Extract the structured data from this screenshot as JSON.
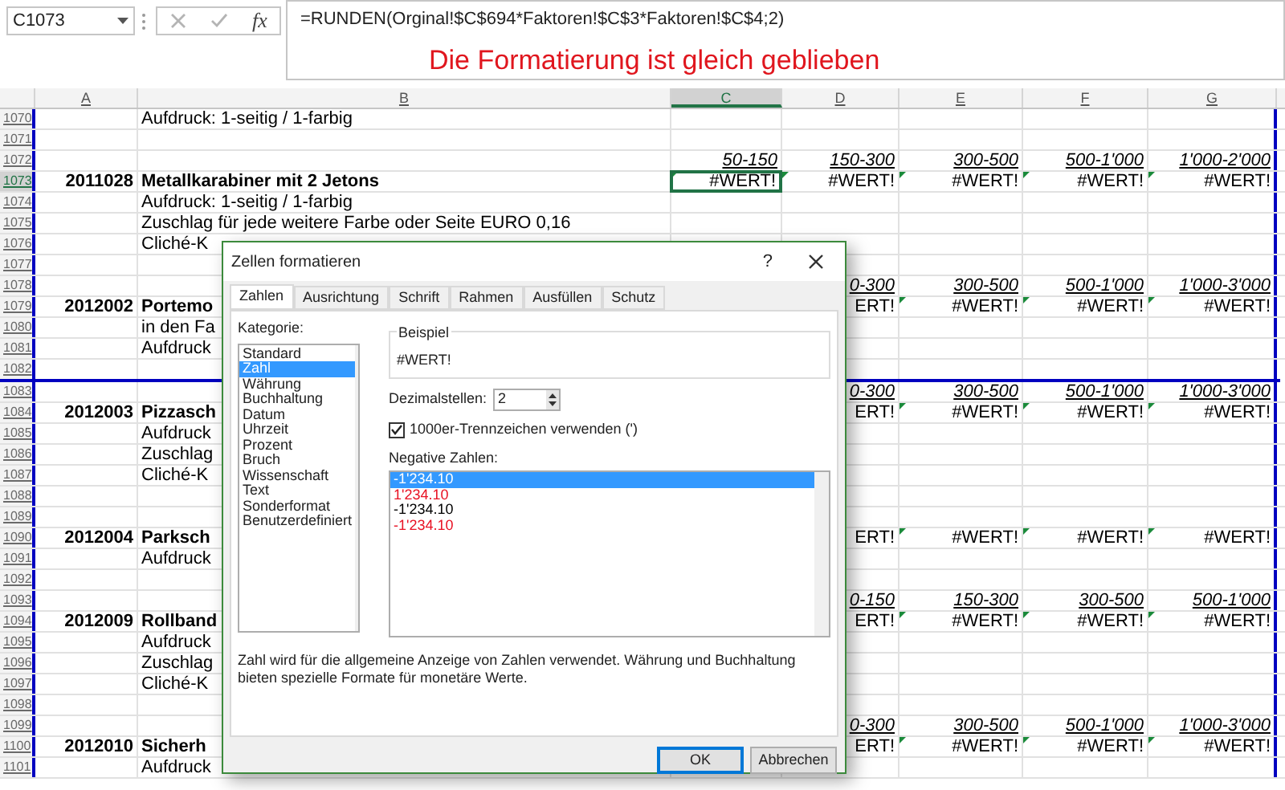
{
  "name_box": {
    "value": "C1073"
  },
  "formula_bar": {
    "function_label": "fx",
    "formula": "=RUNDEN(Orginal!$C$694*Faktoren!$C$3*Faktoren!$C$4;2)",
    "annotation": "Die Formatierung ist gleich geblieben"
  },
  "columns": [
    {
      "label": "A",
      "selected": false
    },
    {
      "label": "B",
      "selected": false
    },
    {
      "label": "C",
      "selected": true
    },
    {
      "label": "D",
      "selected": false
    },
    {
      "label": "E",
      "selected": false
    },
    {
      "label": "F",
      "selected": false
    },
    {
      "label": "G",
      "selected": false
    }
  ],
  "rows": [
    {
      "number": "1070",
      "selected": false,
      "text": "Aufdruck: 1-seitig / 1-farbig"
    },
    {
      "number": "1071",
      "selected": false
    },
    {
      "number": "1072",
      "selected": false,
      "ranges": [
        "50-150",
        "150-300",
        "300-500",
        "500-1'000",
        "1'000-2'000"
      ]
    },
    {
      "number": "1073",
      "selected": true,
      "item_no": "2011028",
      "title": "Metallkarabiner mit 2 Jetons",
      "values": [
        "#WERT!",
        "#WERT!",
        "#WERT!",
        "#WERT!",
        "#WERT!"
      ]
    },
    {
      "number": "1074",
      "selected": false,
      "text": "Aufdruck: 1-seitig / 1-farbig"
    },
    {
      "number": "1075",
      "selected": false,
      "text": "Zuschlag für jede weitere Farbe oder Seite EURO 0,16"
    },
    {
      "number": "1076",
      "selected": false,
      "text": "Cliché-K"
    },
    {
      "number": "1077",
      "selected": false
    },
    {
      "number": "1078",
      "selected": false,
      "ranges": [
        "0-300",
        "300-500",
        "500-1'000",
        "1'000-3'000"
      ]
    },
    {
      "number": "1079",
      "selected": false,
      "item_no": "2012002",
      "title": "Portemo",
      "values": [
        "ERT!",
        "#WERT!",
        "#WERT!",
        "#WERT!"
      ]
    },
    {
      "number": "1080",
      "selected": false,
      "text": "in den Fa"
    },
    {
      "number": "1081",
      "selected": false,
      "text": "Aufdruck"
    },
    {
      "number": "1082",
      "selected": false,
      "page_break_below": true
    },
    {
      "number": "1083",
      "selected": false,
      "ranges": [
        "0-300",
        "300-500",
        "500-1'000",
        "1'000-3'000"
      ]
    },
    {
      "number": "1084",
      "selected": false,
      "item_no": "2012003",
      "title": "Pizzasch",
      "values": [
        "ERT!",
        "#WERT!",
        "#WERT!",
        "#WERT!"
      ]
    },
    {
      "number": "1085",
      "selected": false,
      "text": "Aufdruck"
    },
    {
      "number": "1086",
      "selected": false,
      "text": "Zuschlag"
    },
    {
      "number": "1087",
      "selected": false,
      "text": "Cliché-K"
    },
    {
      "number": "1088",
      "selected": false
    },
    {
      "number": "1089",
      "selected": false
    },
    {
      "number": "1090",
      "selected": false,
      "item_no": "2012004",
      "title": "Parksch",
      "values": [
        "ERT!",
        "#WERT!",
        "#WERT!",
        "#WERT!"
      ]
    },
    {
      "number": "1091",
      "selected": false,
      "text": "Aufdruck"
    },
    {
      "number": "1092",
      "selected": false
    },
    {
      "number": "1093",
      "selected": false,
      "ranges": [
        "0-150",
        "150-300",
        "300-500",
        "500-1'000"
      ]
    },
    {
      "number": "1094",
      "selected": false,
      "item_no": "2012009",
      "title": "Rollband",
      "values": [
        "ERT!",
        "#WERT!",
        "#WERT!",
        "#WERT!"
      ]
    },
    {
      "number": "1095",
      "selected": false,
      "text": "Aufdruck"
    },
    {
      "number": "1096",
      "selected": false,
      "text": "Zuschlag"
    },
    {
      "number": "1097",
      "selected": false,
      "text": "Cliché-K"
    },
    {
      "number": "1098",
      "selected": false
    },
    {
      "number": "1099",
      "selected": false,
      "ranges": [
        "0-300",
        "300-500",
        "500-1'000",
        "1'000-3'000"
      ]
    },
    {
      "number": "1100",
      "selected": false,
      "item_no": "2012010",
      "title": "Sicherh",
      "values": [
        "ERT!",
        "#WERT!",
        "#WERT!",
        "#WERT!"
      ]
    },
    {
      "number": "1101",
      "selected": false,
      "text": "Aufdruck"
    }
  ],
  "dialog": {
    "title": "Zellen formatieren",
    "help": "?",
    "tabs": [
      {
        "label": "Zahlen",
        "selected": true
      },
      {
        "label": "Ausrichtung",
        "selected": false
      },
      {
        "label": "Schrift",
        "selected": false
      },
      {
        "label": "Rahmen",
        "selected": false
      },
      {
        "label": "Ausfüllen",
        "selected": false
      },
      {
        "label": "Schutz",
        "selected": false
      }
    ],
    "category_label": "Kategorie:",
    "categories": [
      {
        "label": "Standard",
        "selected": false
      },
      {
        "label": "Zahl",
        "selected": true
      },
      {
        "label": "Währung",
        "selected": false
      },
      {
        "label": "Buchhaltung",
        "selected": false
      },
      {
        "label": "Datum",
        "selected": false
      },
      {
        "label": "Uhrzeit",
        "selected": false
      },
      {
        "label": "Prozent",
        "selected": false
      },
      {
        "label": "Bruch",
        "selected": false
      },
      {
        "label": "Wissenschaft",
        "selected": false
      },
      {
        "label": "Text",
        "selected": false
      },
      {
        "label": "Sonderformat",
        "selected": false
      },
      {
        "label": "Benutzerdefiniert",
        "selected": false
      }
    ],
    "sample_label": "Beispiel",
    "sample_value": "#WERT!",
    "decimals_label": "Dezimalstellen:",
    "decimals_value": "2",
    "separator": {
      "label": "1000er-Trennzeichen verwenden (')",
      "checked": true
    },
    "negative_label": "Negative Zahlen:",
    "negative_formats": [
      {
        "label": "-1'234.10",
        "selected": true
      },
      {
        "label": "1'234.10",
        "selected": false,
        "color": "#e81123"
      },
      {
        "label": "-1'234.10",
        "selected": false,
        "color": "#000000"
      },
      {
        "label": "-1'234.10",
        "selected": false,
        "color": "#e81123"
      }
    ],
    "description": "Zahl wird für die allgemeine Anzeige von Zahlen verwendet. Währung und Buchhaltung bieten spezielle Formate für monetäre Werte.",
    "buttons": [
      {
        "label": "OK",
        "kind": "default"
      },
      {
        "label": "Abbrechen",
        "kind": "normal"
      }
    ]
  }
}
